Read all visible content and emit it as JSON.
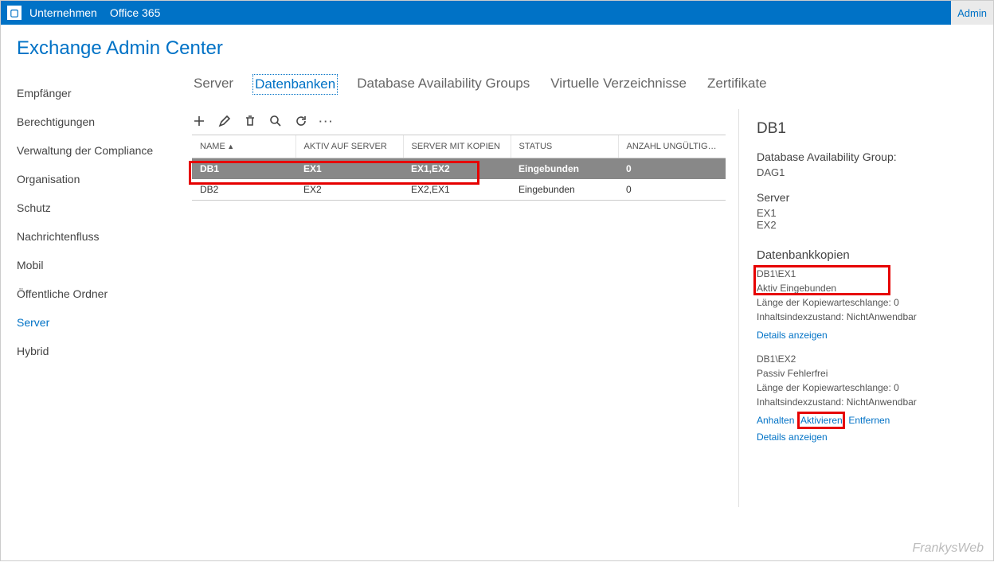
{
  "topbar": {
    "company": "Unternehmen",
    "office": "Office 365",
    "admin": "Admin"
  },
  "heading": "Exchange Admin Center",
  "sidebar": {
    "items": [
      {
        "label": "Empfänger"
      },
      {
        "label": "Berechtigungen"
      },
      {
        "label": "Verwaltung der Compliance"
      },
      {
        "label": "Organisation"
      },
      {
        "label": "Schutz"
      },
      {
        "label": "Nachrichtenfluss"
      },
      {
        "label": "Mobil"
      },
      {
        "label": "Öffentliche Ordner"
      },
      {
        "label": "Server"
      },
      {
        "label": "Hybrid"
      }
    ],
    "active_index": 8
  },
  "tabs": {
    "items": [
      "Server",
      "Datenbanken",
      "Database Availability Groups",
      "Virtuelle Verzeichnisse",
      "Zertifikate"
    ],
    "active_index": 1
  },
  "table": {
    "headers": [
      "NAME",
      "AKTIV AUF SERVER",
      "SERVER MIT KOPIEN",
      "STATUS",
      "ANZAHL UNGÜLTIGE..."
    ],
    "rows": [
      {
        "name": "DB1",
        "active_server": "EX1",
        "copies": "EX1,EX2",
        "status": "Eingebunden",
        "invalid": "0",
        "selected": true
      },
      {
        "name": "DB2",
        "active_server": "EX2",
        "copies": "EX2,EX1",
        "status": "Eingebunden",
        "invalid": "0",
        "selected": false
      }
    ]
  },
  "details": {
    "title": "DB1",
    "dag_label": "Database Availability Group:",
    "dag_value": "DAG1",
    "server_label": "Server",
    "servers": [
      "EX1",
      "EX2"
    ],
    "copies_label": "Datenbankkopien",
    "copy1": {
      "name": "DB1\\EX1",
      "status": "Aktiv Eingebunden",
      "queue": "Länge der Kopiewarteschlange: 0",
      "index": "Inhaltsindexzustand: NichtAnwendbar",
      "link": "Details anzeigen"
    },
    "copy2": {
      "name": "DB1\\EX2",
      "status": " Passiv Fehlerfrei",
      "queue": "Länge der Kopiewarteschlange: 0",
      "index": "Inhaltsindexzustand: NichtAnwendbar",
      "actions": [
        "Anhalten",
        "Aktivieren",
        "Entfernen"
      ],
      "link": "Details anzeigen"
    }
  },
  "watermark": "FrankysWeb"
}
